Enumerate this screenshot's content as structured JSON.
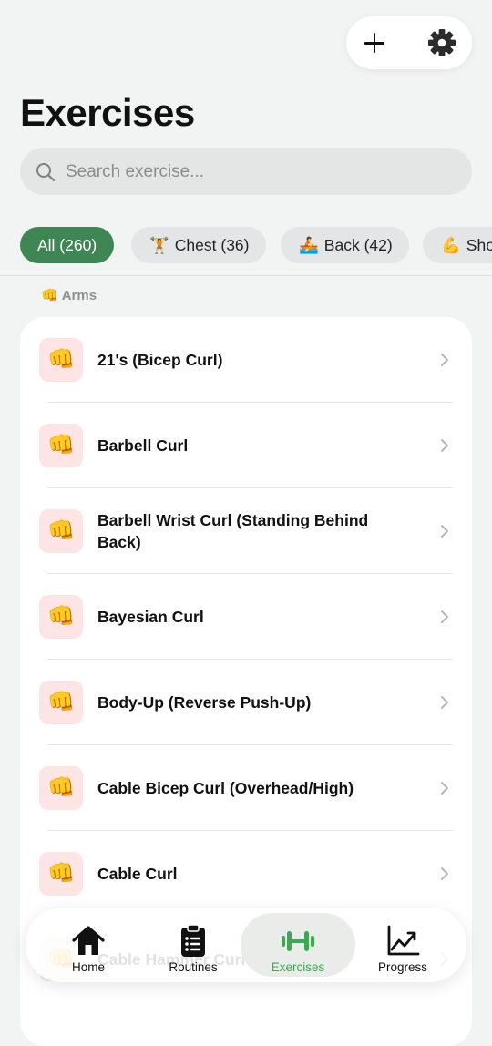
{
  "header": {
    "title": "Exercises",
    "add_icon": "plus-icon",
    "settings_icon": "gear-icon"
  },
  "search": {
    "placeholder": "Search exercise...",
    "icon": "search-icon"
  },
  "filters": [
    {
      "icon": "",
      "label": "All (260)",
      "active": true
    },
    {
      "icon": "🏋️",
      "label": "Chest (36)",
      "active": false
    },
    {
      "icon": "🚣",
      "label": "Back (42)",
      "active": false
    },
    {
      "icon": "💪",
      "label": "Sho",
      "active": false
    }
  ],
  "section": {
    "icon": "👊",
    "label": "Arms"
  },
  "exercises": [
    {
      "icon": "👊",
      "name": "21's (Bicep Curl)"
    },
    {
      "icon": "👊",
      "name": "Barbell Curl"
    },
    {
      "icon": "👊",
      "name": "Barbell Wrist Curl (Standing Behind Back)"
    },
    {
      "icon": "👊",
      "name": "Bayesian Curl"
    },
    {
      "icon": "👊",
      "name": "Body-Up (Reverse Push-Up)"
    },
    {
      "icon": "👊",
      "name": "Cable Bicep Curl (Overhead/High)"
    },
    {
      "icon": "👊",
      "name": "Cable Curl"
    },
    {
      "icon": "👊",
      "name": "Cable Hammer Curl"
    }
  ],
  "tabs": [
    {
      "label": "Home",
      "icon": "home-icon",
      "active": false
    },
    {
      "label": "Routines",
      "icon": "clipboard-icon",
      "active": false
    },
    {
      "label": "Exercises",
      "icon": "dumbbell-icon",
      "active": true
    },
    {
      "label": "Progress",
      "icon": "chart-icon",
      "active": false
    }
  ],
  "colors": {
    "accent": "#3e8754",
    "active_tab": "#3ea851",
    "tile_bg": "#fde5e5",
    "background": "#f2f4f3"
  }
}
